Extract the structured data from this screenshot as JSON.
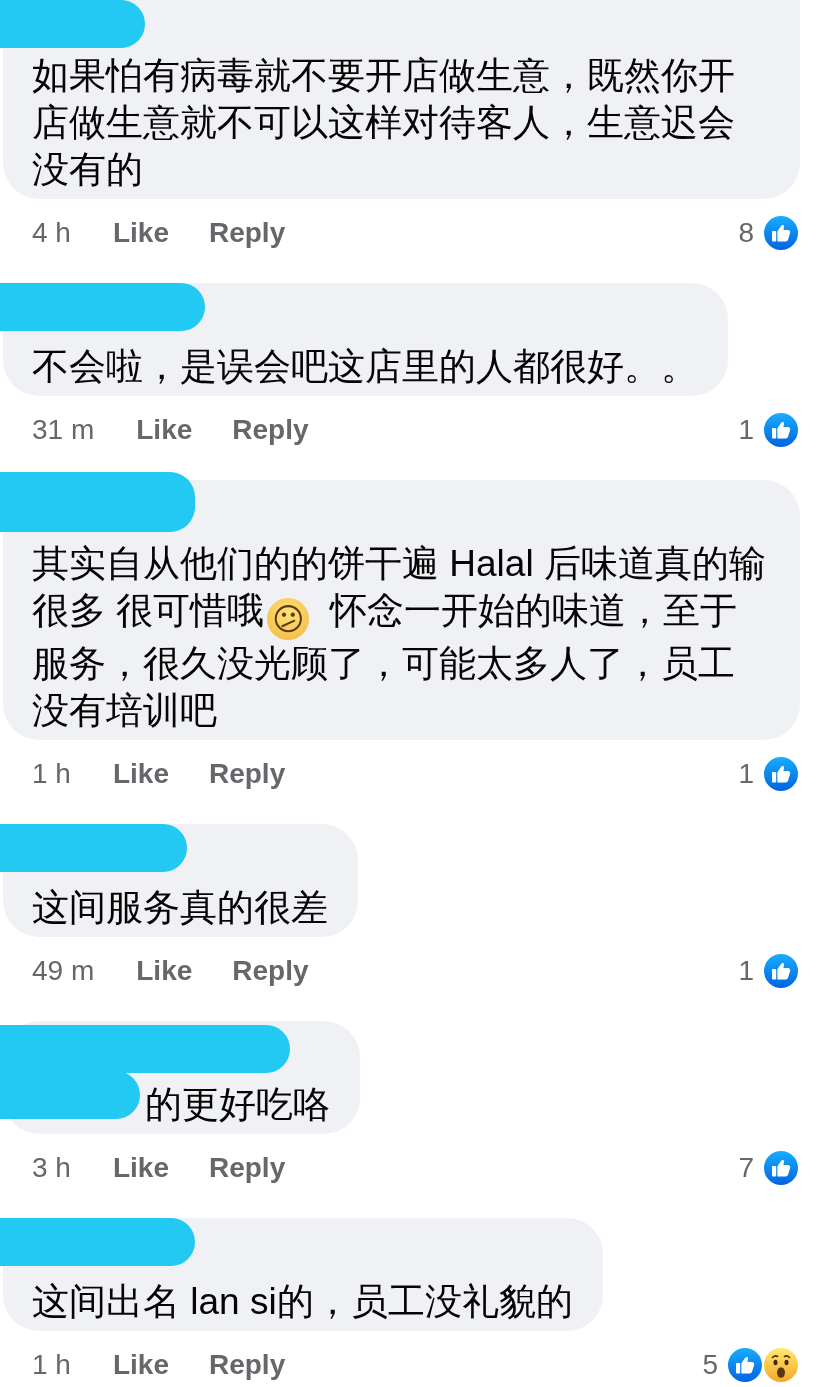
{
  "comments": [
    {
      "name_redacted": true,
      "text_start_redacted": false,
      "text": "如果怕有病毒就不要开店做生意，既然你开店做生意就不可以这样对待客人，生意迟会没有的",
      "time": "4 h",
      "actions": [
        "Like",
        "Reply"
      ],
      "reactions": {
        "count": "8",
        "icons": [
          {
            "kind": "like"
          }
        ]
      }
    },
    {
      "name_redacted": true,
      "text_start_redacted": false,
      "text": "不会啦，是误会吧这店里的人都很好。。",
      "time": "31 m",
      "actions": [
        "Like",
        "Reply"
      ],
      "reactions": {
        "count": "1",
        "icons": [
          {
            "kind": "like"
          }
        ]
      }
    },
    {
      "name_redacted": true,
      "text_start_redacted": false,
      "text": "其实自从他们的的饼干遍 Halal 后味道真的输很多 很可惜哦😕 怀念一开始的味道，至于服务，很久没光顾了，可能太多人了，员工没有培训吧",
      "time": "1 h",
      "actions": [
        "Like",
        "Reply"
      ],
      "reactions": {
        "count": "1",
        "icons": [
          {
            "kind": "like"
          }
        ]
      }
    },
    {
      "name_redacted": true,
      "text_start_redacted": false,
      "text": "这间服务真的很差",
      "time": "49 m",
      "actions": [
        "Like",
        "Reply"
      ],
      "reactions": {
        "count": "1",
        "icons": [
          {
            "kind": "like"
          }
        ]
      }
    },
    {
      "name_redacted": true,
      "text_start_redacted": true,
      "text": "的更好吃咯",
      "time": "3 h",
      "actions": [
        "Like",
        "Reply"
      ],
      "reactions": {
        "count": "7",
        "icons": [
          {
            "kind": "like"
          }
        ]
      }
    },
    {
      "name_redacted": true,
      "text_start_redacted": false,
      "text": "这间出名 lan si的，员工没礼貌的",
      "time": "1 h",
      "actions": [
        "Like",
        "Reply"
      ],
      "reactions": {
        "count": "5",
        "icons": [
          {
            "kind": "like"
          },
          {
            "kind": "wow"
          }
        ]
      }
    }
  ]
}
